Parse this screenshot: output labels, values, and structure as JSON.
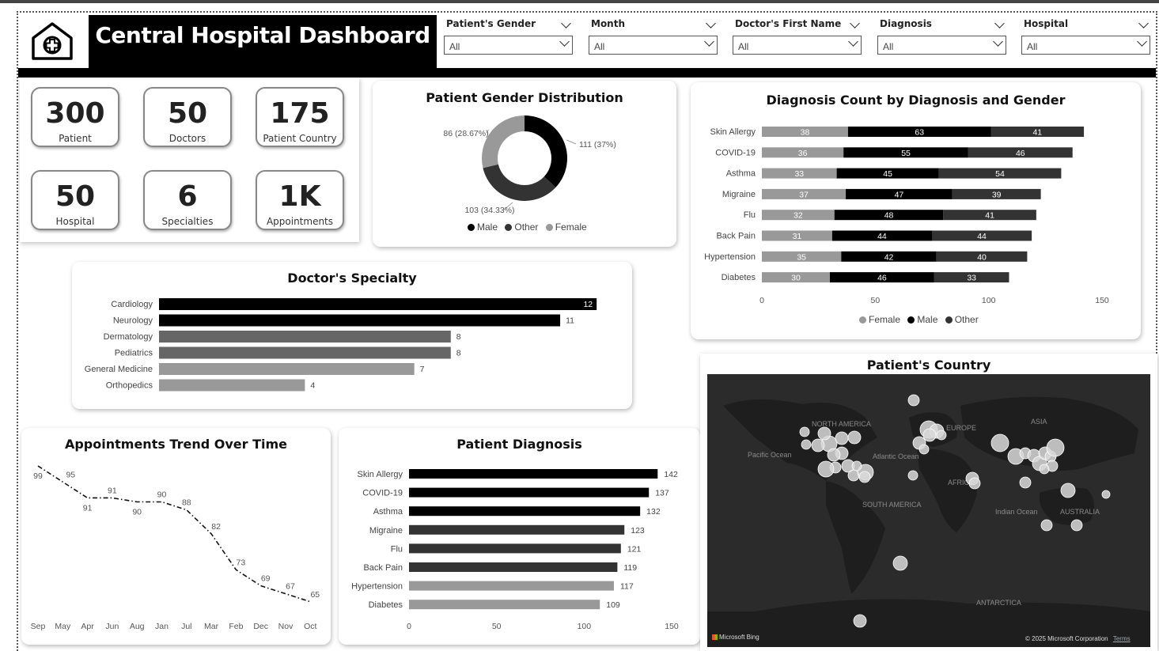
{
  "header": {
    "title": "Central Hospital Dashboard",
    "logo_icon": "hospital-plus-icon"
  },
  "filters": [
    {
      "label": "Patient's Gender",
      "value": "All"
    },
    {
      "label": "Month",
      "value": "All"
    },
    {
      "label": "Doctor's First Name",
      "value": "All"
    },
    {
      "label": "Diagnosis",
      "value": "All"
    },
    {
      "label": "Hospital",
      "value": "All"
    }
  ],
  "kpis": [
    {
      "value": "300",
      "label": "Patient"
    },
    {
      "value": "50",
      "label": "Doctors"
    },
    {
      "value": "175",
      "label": "Patient Country"
    },
    {
      "value": "50",
      "label": "Hospital"
    },
    {
      "value": "6",
      "label": "Specialties"
    },
    {
      "value": "1K",
      "label": "Appointments"
    }
  ],
  "colors": {
    "male": "#000000",
    "other": "#333333",
    "female": "#999999",
    "map_bg": "#2b2b2b"
  },
  "gender_chart": {
    "title": "Patient Gender Distribution",
    "legend": [
      "Male",
      "Other",
      "Female"
    ],
    "chart_data": {
      "type": "pie",
      "labels": [
        "Male",
        "Other",
        "Female"
      ],
      "values": [
        111,
        103,
        86
      ],
      "data_labels": [
        "111 (37%)",
        "103 (34.33%)",
        "86 (28.67%)"
      ]
    }
  },
  "diagnosis_gender_chart": {
    "title": "Diagnosis Count by Diagnosis and Gender",
    "legend": [
      "Female",
      "Male",
      "Other"
    ],
    "x_ticks": [
      "0",
      "50",
      "100",
      "150"
    ],
    "chart_data": {
      "type": "bar",
      "orientation": "horizontal",
      "stacked": true,
      "categories": [
        "Skin Allergy",
        "COVID-19",
        "Asthma",
        "Migraine",
        "Flu",
        "Back Pain",
        "Hypertension",
        "Diabetes"
      ],
      "series": [
        {
          "name": "Female",
          "values": [
            38,
            36,
            33,
            37,
            32,
            31,
            35,
            30
          ]
        },
        {
          "name": "Male",
          "values": [
            63,
            55,
            45,
            47,
            48,
            44,
            42,
            46
          ]
        },
        {
          "name": "Other",
          "values": [
            41,
            46,
            54,
            39,
            41,
            44,
            40,
            33
          ]
        }
      ],
      "xlim": [
        0,
        150
      ]
    }
  },
  "specialty_chart": {
    "title": "Doctor's Specialty",
    "chart_data": {
      "type": "bar",
      "orientation": "horizontal",
      "categories": [
        "Cardiology",
        "Neurology",
        "Dermatology",
        "Pediatrics",
        "General Medicine",
        "Orthopedics"
      ],
      "values": [
        12,
        11,
        8,
        8,
        7,
        4
      ],
      "bar_colors": [
        "#000000",
        "#000000",
        "#666666",
        "#666666",
        "#999999",
        "#999999"
      ],
      "xlim": [
        0,
        12.3
      ]
    }
  },
  "appointments_chart": {
    "title": "Appointments Trend Over Time",
    "chart_data": {
      "type": "line",
      "categories": [
        "Sep",
        "May",
        "Apr",
        "Jun",
        "Aug",
        "Jan",
        "Jul",
        "Mar",
        "Feb",
        "Dec",
        "Nov",
        "Oct"
      ],
      "values": [
        99,
        95,
        91,
        91,
        90,
        90,
        88,
        82,
        73,
        69,
        67,
        65
      ],
      "line_style": "dash-dot"
    }
  },
  "diagnosis_chart": {
    "title": "Patient Diagnosis",
    "x_ticks": [
      "0",
      "50",
      "100",
      "150"
    ],
    "chart_data": {
      "type": "bar",
      "orientation": "horizontal",
      "categories": [
        "Skin Allergy",
        "COVID-19",
        "Asthma",
        "Migraine",
        "Flu",
        "Back Pain",
        "Hypertension",
        "Diabetes"
      ],
      "values": [
        142,
        137,
        132,
        123,
        121,
        119,
        117,
        109
      ],
      "bar_colors": [
        "#000000",
        "#000000",
        "#000000",
        "#333333",
        "#333333",
        "#333333",
        "#999999",
        "#999999"
      ],
      "xlim": [
        0,
        150
      ]
    }
  },
  "map": {
    "title": "Patient's Country",
    "labels": [
      "NORTH AMERICA",
      "EUROPE",
      "ASIA",
      "Pacific Ocean",
      "Atlantic Ocean",
      "AFRICA",
      "SOUTH AMERICA",
      "Indian Ocean",
      "AUSTRALIA",
      "ANTARCTICA"
    ],
    "footer_left": "Microsoft Bing",
    "footer_right": "© 2025 Microsoft Corporation",
    "terms": "Terms"
  }
}
